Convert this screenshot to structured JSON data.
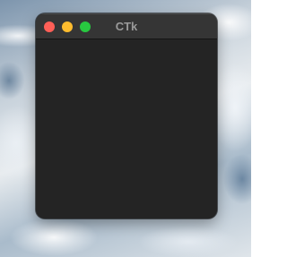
{
  "window": {
    "title": "CTk",
    "controls": [
      {
        "name": "close",
        "color": "#ff5f57"
      },
      {
        "name": "minimize",
        "color": "#febc2e"
      },
      {
        "name": "zoom",
        "color": "#28c840"
      }
    ],
    "background_color": "#242424",
    "titlebar_color": "#353535"
  }
}
